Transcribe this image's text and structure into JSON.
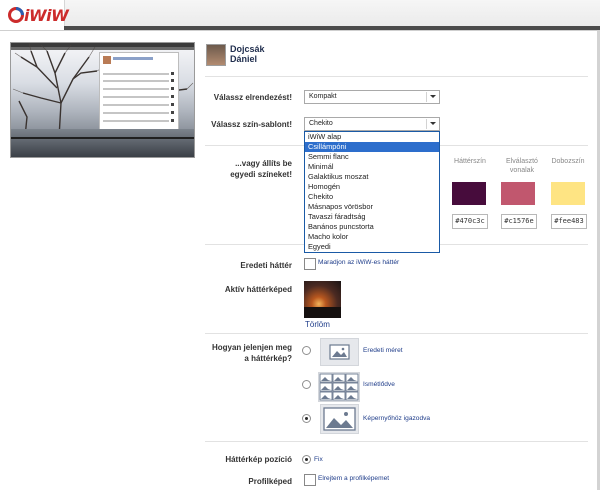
{
  "app": {
    "logo_text": "iWiW"
  },
  "user": {
    "name": "Dojcsák Dániel"
  },
  "layout": {
    "label": "Válassz elrendezést!",
    "selected": "Kompakt"
  },
  "theme": {
    "label": "Válassz szín-sablont!",
    "selected": "Chekito",
    "options": [
      "iWiW alap",
      "Csillámpóni",
      "Semmi flanc",
      "Minimál",
      "Galaktikus moszat",
      "Homogén",
      "Chekito",
      "Másnapos vörösbor",
      "Tavaszi fáradtság",
      "Banános puncstorta",
      "Macho kolor",
      "Egyedi"
    ],
    "highlighted_index": 1
  },
  "custom_colors": {
    "label": "...vagy állíts be egyedi színeket!",
    "columns": [
      {
        "label": "Háttérszín",
        "hex": "#470c3c",
        "color": "#470c3c"
      },
      {
        "label": "Elválasztó vonalak",
        "hex": "#c1576e",
        "color": "#c1576e"
      },
      {
        "label": "Dobozszín",
        "hex": "#fee483",
        "color": "#fee483"
      }
    ]
  },
  "original_bg": {
    "label": "Eredeti háttér",
    "checkbox_label": "Maradjon az iWiW-es háttér",
    "checked": false
  },
  "active_bg": {
    "label": "Aktív háttérképed",
    "delete_label": "Törlöm"
  },
  "display_mode": {
    "label": "Hogyan jelenjen meg a háttérkép?",
    "options": [
      {
        "label": "Eredeti méret",
        "selected": false
      },
      {
        "label": "Ismétlődve",
        "selected": false
      },
      {
        "label": "Képernyőhöz igazodva",
        "selected": true
      }
    ]
  },
  "bg_position": {
    "label": "Háttérkép pozíció",
    "option_label": "Fix",
    "selected": true
  },
  "profile_pic": {
    "label": "Profilképed",
    "checkbox_label": "Elrejtem a profilképemet",
    "checked": false
  }
}
